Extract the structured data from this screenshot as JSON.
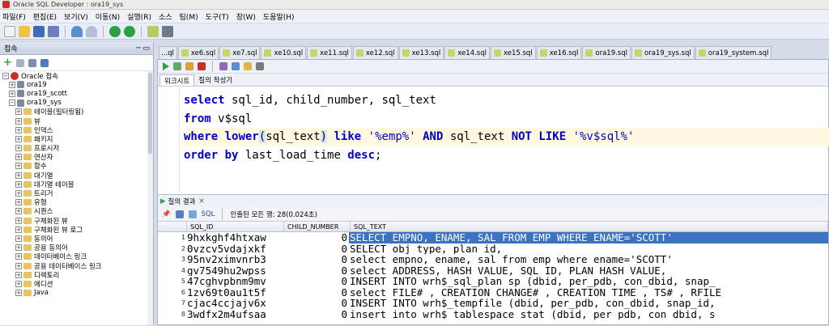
{
  "window": {
    "title": "Oracle SQL Developer : ora19_sys"
  },
  "menu": [
    "파일(F)",
    "편집(E)",
    "보기(V)",
    "이동(N)",
    "실행(R)",
    "소스",
    "팀(M)",
    "도구(T)",
    "창(W)",
    "도움말(H)"
  ],
  "connections_panel": {
    "title": "접속",
    "items": [
      {
        "label": "Oracle 접속",
        "level": 0,
        "expanded": true,
        "icon": "folder"
      },
      {
        "label": "ora19",
        "level": 1,
        "expanded": false,
        "icon": "db"
      },
      {
        "label": "ora19_scott",
        "level": 1,
        "expanded": false,
        "icon": "db"
      },
      {
        "label": "ora19_sys",
        "level": 1,
        "expanded": true,
        "icon": "db"
      },
      {
        "label": "테이블(필터링됨)",
        "level": 2,
        "icon": "folder"
      },
      {
        "label": "뷰",
        "level": 2,
        "icon": "folder"
      },
      {
        "label": "인덱스",
        "level": 2,
        "icon": "folder"
      },
      {
        "label": "패키지",
        "level": 2,
        "icon": "folder"
      },
      {
        "label": "프로시저",
        "level": 2,
        "icon": "folder"
      },
      {
        "label": "연산자",
        "level": 2,
        "icon": "folder"
      },
      {
        "label": "함수",
        "level": 2,
        "icon": "folder"
      },
      {
        "label": "대기열",
        "level": 2,
        "icon": "folder"
      },
      {
        "label": "대기열 테이블",
        "level": 2,
        "icon": "folder"
      },
      {
        "label": "트리거",
        "level": 2,
        "icon": "folder"
      },
      {
        "label": "유형",
        "level": 2,
        "icon": "folder"
      },
      {
        "label": "시퀀스",
        "level": 2,
        "icon": "folder"
      },
      {
        "label": "구체화된 뷰",
        "level": 2,
        "icon": "folder"
      },
      {
        "label": "구체화된 뷰 로그",
        "level": 2,
        "icon": "folder"
      },
      {
        "label": "동의어",
        "level": 2,
        "icon": "folder"
      },
      {
        "label": "공용 동의어",
        "level": 2,
        "icon": "folder"
      },
      {
        "label": "데이터베이스 링크",
        "level": 2,
        "icon": "folder"
      },
      {
        "label": "공용 데이터베이스 링크",
        "level": 2,
        "icon": "folder"
      },
      {
        "label": "디렉토리",
        "level": 2,
        "icon": "folder"
      },
      {
        "label": "에디션",
        "level": 2,
        "icon": "folder"
      },
      {
        "label": "Java",
        "level": 2,
        "icon": "folder"
      }
    ]
  },
  "tabs": [
    "...ql",
    "xe6.sql",
    "xe7.sql",
    "xe10.sql",
    "xe11.sql",
    "xe12.sql",
    "xe13.sql",
    "xe14.sql",
    "xe15.sql",
    "xe16.sql",
    "ora19.sql",
    "ora19_sys.sql",
    "ora19_system.sql"
  ],
  "worksheet": {
    "subtabs": [
      "워크시트",
      "질의 작성기"
    ],
    "code_lines": [
      [
        {
          "t": "select",
          "c": "kw"
        },
        {
          "t": " sql_id, child_number, sql_text",
          "c": ""
        }
      ],
      [
        {
          "t": "from",
          "c": "kw"
        },
        {
          "t": " v$sql",
          "c": ""
        }
      ],
      [
        {
          "t": "where",
          "c": "kw"
        },
        {
          "t": " ",
          "c": ""
        },
        {
          "t": "lower",
          "c": "kw"
        },
        {
          "t": "(",
          "c": "brk"
        },
        {
          "t": "sql_text",
          "c": ""
        },
        {
          "t": ")",
          "c": "brk"
        },
        {
          "t": " ",
          "c": ""
        },
        {
          "t": "like",
          "c": "kw"
        },
        {
          "t": " ",
          "c": ""
        },
        {
          "t": "'%emp%'",
          "c": "str"
        },
        {
          "t": " ",
          "c": ""
        },
        {
          "t": "AND",
          "c": "kw"
        },
        {
          "t": " sql_text ",
          "c": ""
        },
        {
          "t": "NOT LIKE",
          "c": "kw"
        },
        {
          "t": " ",
          "c": ""
        },
        {
          "t": "'%v$sql%'",
          "c": "str"
        }
      ],
      [
        {
          "t": "order by",
          "c": "kw"
        },
        {
          "t": " last_load_time ",
          "c": ""
        },
        {
          "t": "desc",
          "c": "kw"
        },
        {
          "t": ";",
          "c": ""
        }
      ]
    ]
  },
  "results": {
    "tab_label": "질의 결과",
    "close_label": "×",
    "sql_label": "SQL",
    "status": "인출된 모든 행: 28(0.024초)",
    "columns": [
      "SQL_ID",
      "CHILD_NUMBER",
      "SQL_TEXT"
    ],
    "rows": [
      [
        "1",
        "9hxkghf4htxaw",
        "0",
        "SELECT EMPNO, ENAME, SAL FROM EMP WHERE ENAME='SCOTT'"
      ],
      [
        "2",
        "0vzcv5vdajxkf",
        "0",
        "SELECT    obj_type, plan_id,"
      ],
      [
        "3",
        "95nv2ximvnrb3",
        "0",
        "select empno, ename, sal from emp where ename='SCOTT'"
      ],
      [
        "4",
        "gv7549hu2wpss",
        "0",
        "select ADDRESS, HASH_VALUE, SQL_ID, PLAN_HASH_VALUE,"
      ],
      [
        "5",
        "47cghvpbnm9mv",
        "0",
        "INSERT INTO  wrh$_sql_plan  sp  (dbid, per_pdb, con_dbid, snap_"
      ],
      [
        "6",
        "1zv69t0au1t5f",
        "0",
        "select  FILE# , CREATION_CHANGE# , CREATION_TIME , TS# , RFILE"
      ],
      [
        "7",
        "cjac4ccjajv6x",
        "0",
        "INSERT INTO  wrh$_tempfile  (dbid, per_pdb, con_dbid, snap_id,"
      ],
      [
        "8",
        "3wdfx2m4ufsaa",
        "0",
        "insert into  wrh$_tablespace_stat  (dbid, per_pdb, con_dbid, s"
      ]
    ],
    "selected_row": 0
  }
}
